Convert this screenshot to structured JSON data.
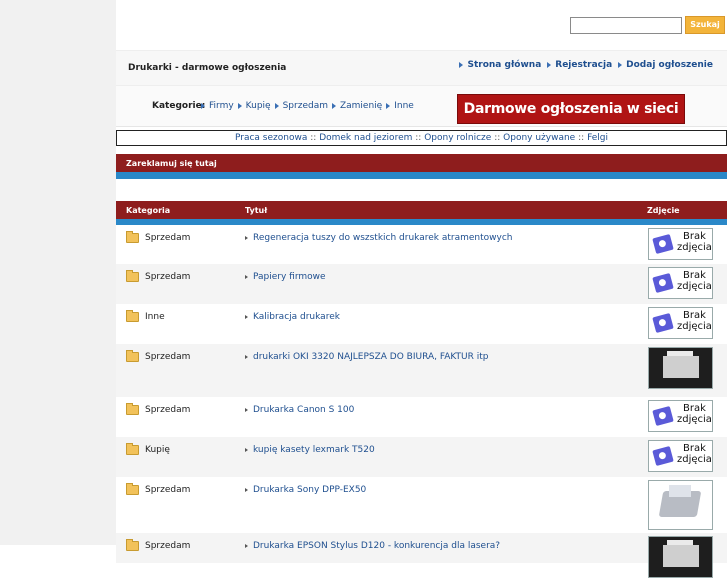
{
  "search": {
    "placeholder": "",
    "button_label": "Szukaj"
  },
  "header": {
    "title": "Drukarki - darmowe ogłoszenia",
    "nav": [
      "Strona główna",
      "Rejestracja",
      "Dodaj ogłoszenie"
    ]
  },
  "categories": {
    "label": "Kategorie:",
    "items": [
      "Firmy",
      "Kupię",
      "Sprzedam",
      "Zamienię",
      "Inne"
    ]
  },
  "banner": {
    "text": "Darmowe ogłoszenia w sieci !!"
  },
  "links": [
    "Praca sezonowa",
    "Domek nad jeziorem",
    "Opony rolnicze",
    "Opony używane",
    "Felgi"
  ],
  "links_separator": "::",
  "ad_bar": {
    "text": "Zareklamuj się tutaj"
  },
  "table": {
    "headers": {
      "category": "Kategoria",
      "title": "Tytuł",
      "photo": "Zdjęcie"
    },
    "no_photo_label": [
      "Brak",
      "zdjęcia"
    ],
    "rows": [
      {
        "category": "Sprzedam",
        "title": "Regeneracja tuszy do wszstkich drukarek atramentowych",
        "photo": "none"
      },
      {
        "category": "Sprzedam",
        "title": "Papiery firmowe",
        "photo": "none"
      },
      {
        "category": "Inne",
        "title": "Kalibracja drukarek",
        "photo": "none"
      },
      {
        "category": "Sprzedam",
        "title": "drukarki OKI 3320 NAJLEPSZA DO BIURA, FAKTUR itp",
        "photo": "printer"
      },
      {
        "category": "Sprzedam",
        "title": "Drukarka Canon S 100",
        "photo": "none"
      },
      {
        "category": "Kupię",
        "title": "kupię kasety lexmark T520",
        "photo": "none"
      },
      {
        "category": "Sprzedam",
        "title": "Drukarka Sony DPP-EX50",
        "photo": "sony"
      },
      {
        "category": "Sprzedam",
        "title": "Drukarka EPSON Stylus D120 - konkurencja dla lasera?",
        "photo": "printer"
      }
    ]
  },
  "colors": {
    "link": "#1f4f8f",
    "header_bar": "#8e1d1d",
    "accent_bar": "#2a88c8",
    "row_alt": "#f4f4f4",
    "banner": "#b01414",
    "search_button": "#f3b43a"
  }
}
